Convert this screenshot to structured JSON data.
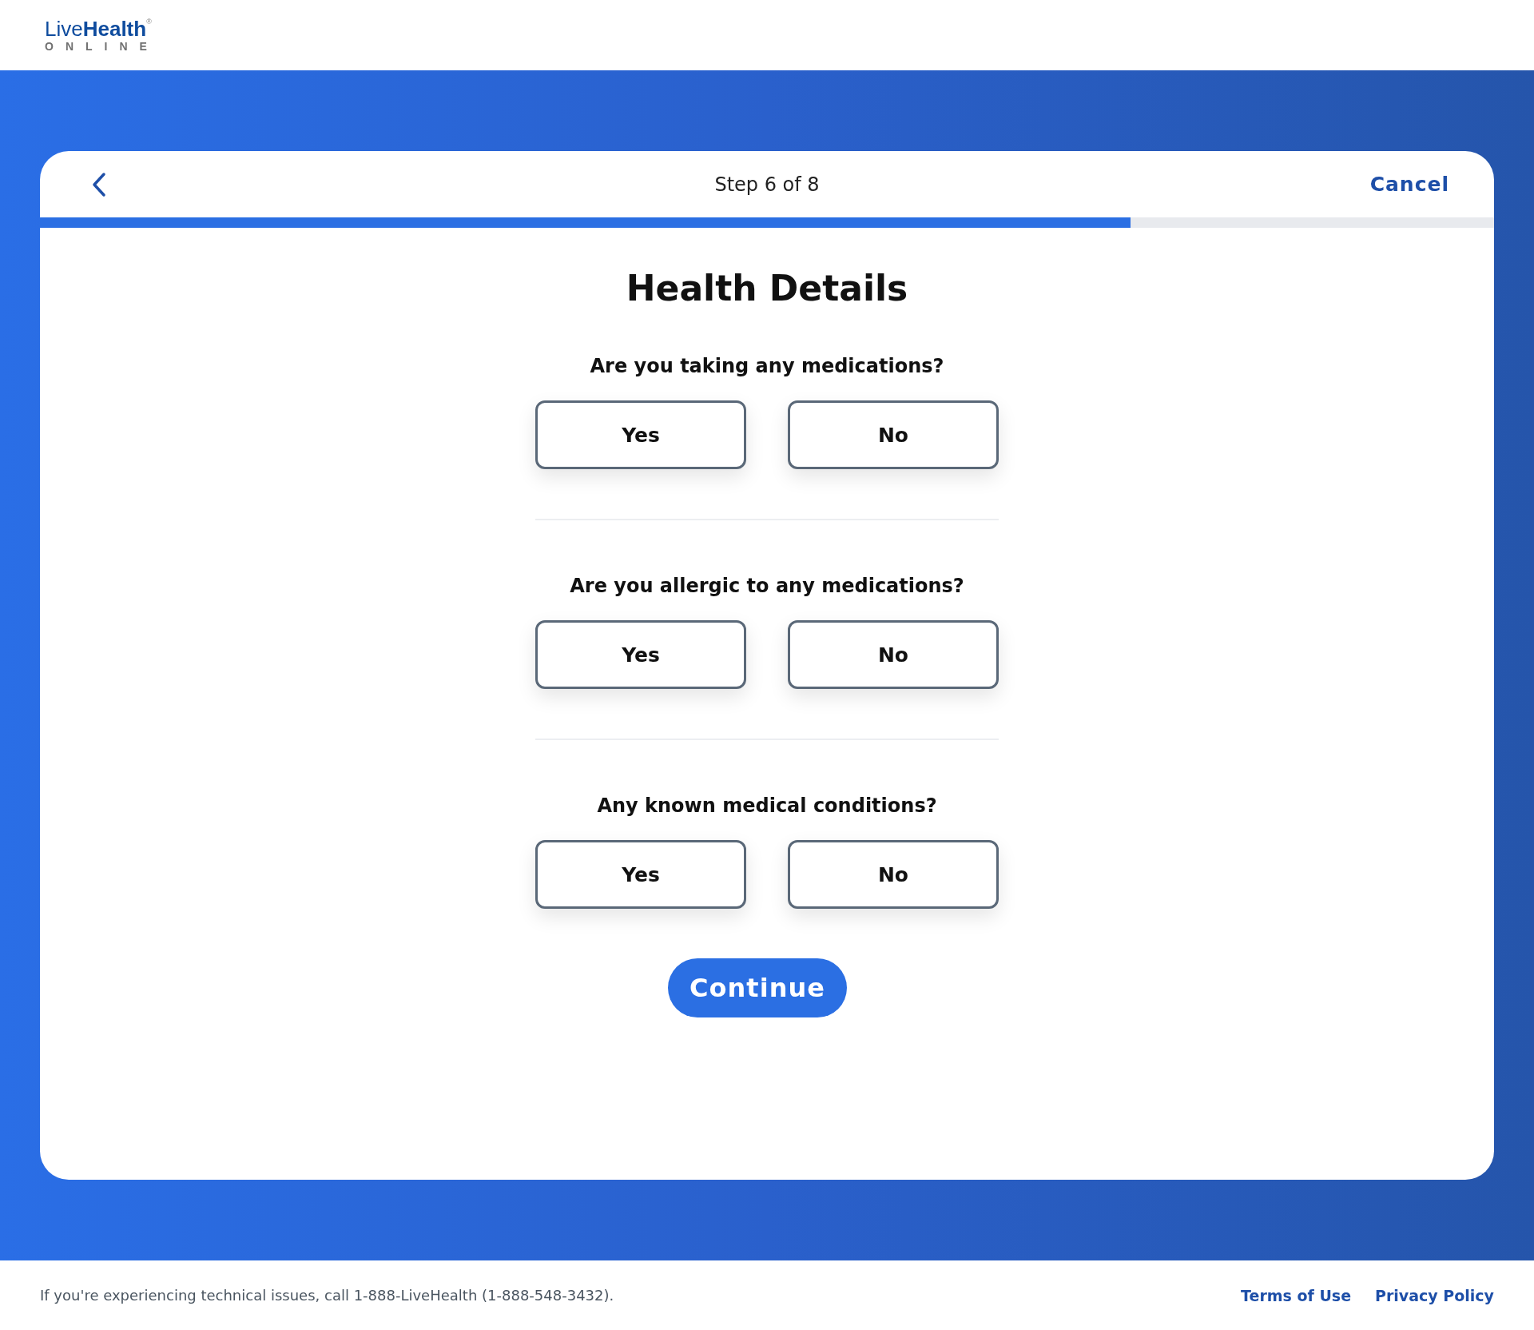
{
  "logo": {
    "word_light": "Live",
    "word_bold": "Health",
    "mark": "®",
    "subline": "ONLINE"
  },
  "header": {
    "step": "Step 6 of 8",
    "cancel": "Cancel",
    "progress": {
      "level": 0.75
    }
  },
  "title": "Health Details",
  "questions": [
    {
      "text": "Are you taking any medications?",
      "options": [
        {
          "label": "Yes",
          "selected": false
        },
        {
          "label": "No",
          "selected": false
        }
      ]
    },
    {
      "text": "Are you allergic to any medications?",
      "options": [
        {
          "label": "Yes",
          "selected": false
        },
        {
          "label": "No",
          "selected": false
        }
      ]
    },
    {
      "text": "Any known medical conditions?",
      "options": [
        {
          "label": "Yes",
          "selected": false
        },
        {
          "label": "No",
          "selected": false
        }
      ]
    }
  ],
  "continue": "Continue",
  "footer": {
    "note": "If you're experiencing technical issues, call 1-888-LiveHealth (1-888-548-3432).",
    "links": [
      "Terms of Use",
      "Privacy Policy"
    ]
  }
}
